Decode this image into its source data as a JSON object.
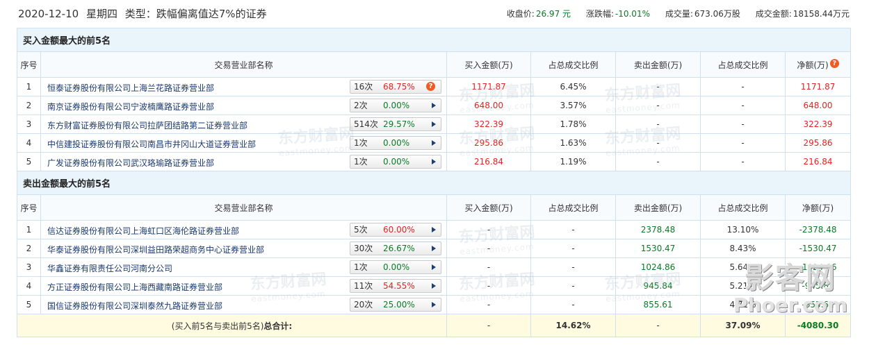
{
  "header": {
    "date": "2020-12-10",
    "weekday": "星期四",
    "type_label": "类型：跌幅偏离值达7%的证券",
    "close_label": "收盘价:",
    "close_value": "26.97 元",
    "change_label": "涨跌幅:",
    "change_value": "-10.01%",
    "volume_label": "成交量:",
    "volume_value": "673.06万股",
    "amount_label": "成交金额:",
    "amount_value": "18158.44万元"
  },
  "columns": {
    "seq": "序号",
    "name": "交易营业部名称",
    "buy": "买入金额(万)",
    "buy_ratio": "占总成交比例",
    "sell": "卖出金额(万)",
    "sell_ratio": "占总成交比例",
    "net": "净额(万)"
  },
  "buy_section": {
    "title": "买入金额最大的前5名",
    "rows": [
      {
        "idx": "1",
        "name": "恒泰证券股份有限公司上海兰花路证券营业部",
        "count": "16次",
        "pct": "68.75%",
        "pct_color": "red",
        "icon": "question-icon",
        "buy": "1171.87",
        "buy_ratio": "6.45%",
        "sell": "-",
        "sell_ratio": "-",
        "net": "1171.87"
      },
      {
        "idx": "2",
        "name": "南京证券股份有限公司宁波楠鹰路证券营业部",
        "count": "2次",
        "pct": "0.00%",
        "pct_color": "green",
        "icon": "arrow-right-icon",
        "buy": "648.00",
        "buy_ratio": "3.57%",
        "sell": "-",
        "sell_ratio": "-",
        "net": "648.00"
      },
      {
        "idx": "3",
        "name": "东方财富证券股份有限公司拉萨团结路第二证券营业部",
        "count": "514次",
        "pct": "29.57%",
        "pct_color": "green",
        "icon": "arrow-right-icon",
        "buy": "322.39",
        "buy_ratio": "1.78%",
        "sell": "-",
        "sell_ratio": "-",
        "net": "322.39"
      },
      {
        "idx": "4",
        "name": "中信建投证券股份有限公司南昌市井冈山大道证券营业部",
        "count": "1次",
        "pct": "0.00%",
        "pct_color": "green",
        "icon": "arrow-right-icon",
        "buy": "295.86",
        "buy_ratio": "1.63%",
        "sell": "-",
        "sell_ratio": "-",
        "net": "295.86"
      },
      {
        "idx": "5",
        "name": "广发证券股份有限公司武汉珞瑜路证券营业部",
        "count": "1次",
        "pct": "0.00%",
        "pct_color": "green",
        "icon": "arrow-right-icon",
        "buy": "216.84",
        "buy_ratio": "1.19%",
        "sell": "-",
        "sell_ratio": "-",
        "net": "216.84"
      }
    ]
  },
  "sell_section": {
    "title": "卖出金额最大的前5名",
    "rows": [
      {
        "idx": "1",
        "name": "信达证券股份有限公司上海虹口区海伦路证券营业部",
        "count": "5次",
        "pct": "60.00%",
        "pct_color": "red",
        "icon": "arrow-right-icon",
        "buy": "-",
        "buy_ratio": "-",
        "sell": "2378.48",
        "sell_ratio": "13.10%",
        "net": "-2378.48"
      },
      {
        "idx": "2",
        "name": "华泰证券股份有限公司深圳益田路荣超商务中心证券营业部",
        "count": "30次",
        "pct": "26.67%",
        "pct_color": "green",
        "icon": "arrow-right-icon",
        "buy": "-",
        "buy_ratio": "-",
        "sell": "1530.47",
        "sell_ratio": "8.43%",
        "net": "-1530.47"
      },
      {
        "idx": "3",
        "name": "华鑫证券有限责任公司河南分公司",
        "count": "1次",
        "pct": "0.00%",
        "pct_color": "green",
        "icon": "arrow-right-icon",
        "buy": "-",
        "buy_ratio": "-",
        "sell": "1024.86",
        "sell_ratio": "5.64%",
        "net": "-1024.86"
      },
      {
        "idx": "4",
        "name": "方正证券股份有限公司上海西藏南路证券营业部",
        "count": "11次",
        "pct": "54.55%",
        "pct_color": "red",
        "icon": "arrow-right-icon",
        "buy": "-",
        "buy_ratio": "-",
        "sell": "945.84",
        "sell_ratio": "5.21%",
        "net": "-945.84"
      },
      {
        "idx": "5",
        "name": "国信证券股份有限公司深圳泰然九路证券营业部",
        "count": "20次",
        "pct": "25.00%",
        "pct_color": "green",
        "icon": "arrow-right-icon",
        "buy": "-",
        "buy_ratio": "-",
        "sell": "855.61",
        "sell_ratio": "4.71%",
        "net": "-855.61"
      }
    ]
  },
  "total": {
    "label_paren": "(买入前5名与卖出前5名)",
    "label_bold": "总合计:",
    "buy": "-",
    "buy_ratio": "14.62%",
    "sell": "-",
    "sell_ratio": "37.09%",
    "net": "-4080.30"
  },
  "watermark": {
    "cn": "东方财富网",
    "en": "eastmoney.com",
    "corner_cn": "影客网",
    "corner_en": "Phoer.com"
  },
  "colors": {
    "buy_red": "#e62222",
    "sell_green": "#0a7c24",
    "section_bg": "#eaf4fb",
    "total_bg": "#fffbe0",
    "border": "#cfe0ef",
    "icon_orange": "#f15a22"
  }
}
